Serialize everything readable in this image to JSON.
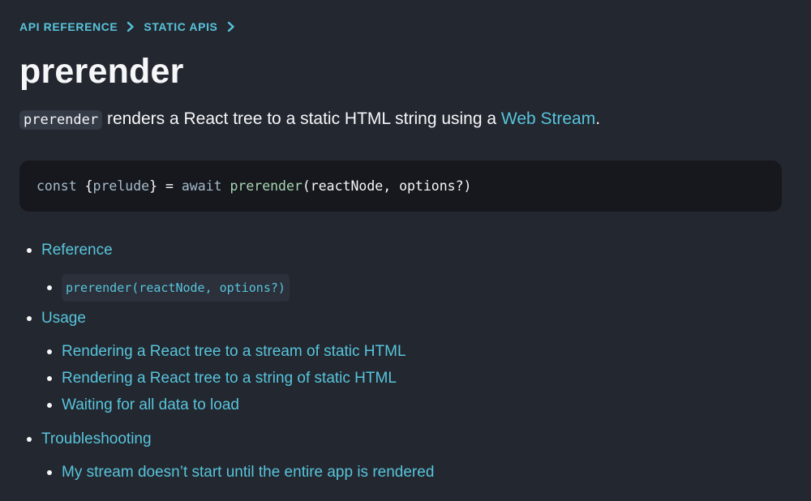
{
  "breadcrumbs": [
    {
      "label": "API REFERENCE"
    },
    {
      "label": "STATIC APIS"
    }
  ],
  "page": {
    "title": "prerender",
    "intro": {
      "code": "prerender",
      "text": " renders a React tree to a static HTML string using a ",
      "link": "Web Stream",
      "end": "."
    }
  },
  "code_block": {
    "tokens": [
      {
        "t": "const",
        "c": "kw"
      },
      {
        "t": " ",
        "c": "plain"
      },
      {
        "t": "{",
        "c": "punct"
      },
      {
        "t": "prelude",
        "c": "prop"
      },
      {
        "t": "}",
        "c": "punct"
      },
      {
        "t": " = ",
        "c": "plain"
      },
      {
        "t": "await",
        "c": "kw"
      },
      {
        "t": " ",
        "c": "plain"
      },
      {
        "t": "prerender",
        "c": "fn"
      },
      {
        "t": "(reactNode, options?)",
        "c": "plain"
      }
    ]
  },
  "toc": {
    "reference": "Reference",
    "reference_sig": "prerender(reactNode, options?)",
    "usage": "Usage",
    "usage_1": "Rendering a React tree to a stream of static HTML",
    "usage_2": "Rendering a React tree to a string of static HTML",
    "usage_3": "Waiting for all data to load",
    "troubleshooting": "Troubleshooting",
    "troubleshooting_1": "My stream doesn’t start until the entire app is rendered"
  },
  "colors": {
    "background": "#23272f",
    "link": "#58c4dc",
    "code_bg": "#16181d",
    "text": "#f6f7f9"
  },
  "icons": {
    "breadcrumb_separator": "chevron-right-icon",
    "list_marker": "bullet-icon"
  }
}
